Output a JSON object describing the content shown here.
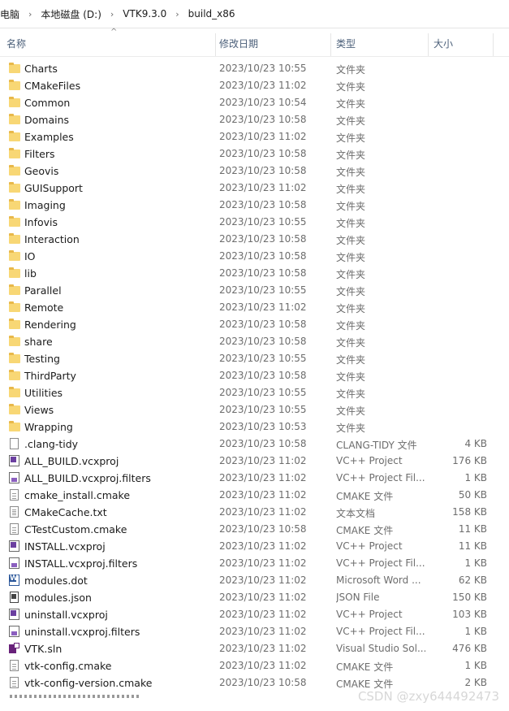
{
  "breadcrumb": {
    "items": [
      "电脑",
      "本地磁盘 (D:)",
      "VTK9.3.0",
      "build_x86"
    ],
    "separator": "›"
  },
  "columns": {
    "name": "名称",
    "date": "修改日期",
    "type": "类型",
    "size": "大小",
    "sort_indicator": "^"
  },
  "files": [
    {
      "name": "Charts",
      "date": "2023/10/23 10:55",
      "type": "文件夹",
      "size": "",
      "icon": "folder-icon"
    },
    {
      "name": "CMakeFiles",
      "date": "2023/10/23 11:02",
      "type": "文件夹",
      "size": "",
      "icon": "folder-icon"
    },
    {
      "name": "Common",
      "date": "2023/10/23 10:54",
      "type": "文件夹",
      "size": "",
      "icon": "folder-icon"
    },
    {
      "name": "Domains",
      "date": "2023/10/23 10:58",
      "type": "文件夹",
      "size": "",
      "icon": "folder-icon"
    },
    {
      "name": "Examples",
      "date": "2023/10/23 11:02",
      "type": "文件夹",
      "size": "",
      "icon": "folder-icon"
    },
    {
      "name": "Filters",
      "date": "2023/10/23 10:58",
      "type": "文件夹",
      "size": "",
      "icon": "folder-icon"
    },
    {
      "name": "Geovis",
      "date": "2023/10/23 10:58",
      "type": "文件夹",
      "size": "",
      "icon": "folder-icon"
    },
    {
      "name": "GUISupport",
      "date": "2023/10/23 11:02",
      "type": "文件夹",
      "size": "",
      "icon": "folder-icon"
    },
    {
      "name": "Imaging",
      "date": "2023/10/23 10:58",
      "type": "文件夹",
      "size": "",
      "icon": "folder-icon"
    },
    {
      "name": "Infovis",
      "date": "2023/10/23 10:55",
      "type": "文件夹",
      "size": "",
      "icon": "folder-icon"
    },
    {
      "name": "Interaction",
      "date": "2023/10/23 10:58",
      "type": "文件夹",
      "size": "",
      "icon": "folder-icon"
    },
    {
      "name": "IO",
      "date": "2023/10/23 10:58",
      "type": "文件夹",
      "size": "",
      "icon": "folder-icon"
    },
    {
      "name": "lib",
      "date": "2023/10/23 10:58",
      "type": "文件夹",
      "size": "",
      "icon": "folder-icon"
    },
    {
      "name": "Parallel",
      "date": "2023/10/23 10:55",
      "type": "文件夹",
      "size": "",
      "icon": "folder-icon"
    },
    {
      "name": "Remote",
      "date": "2023/10/23 11:02",
      "type": "文件夹",
      "size": "",
      "icon": "folder-icon"
    },
    {
      "name": "Rendering",
      "date": "2023/10/23 10:58",
      "type": "文件夹",
      "size": "",
      "icon": "folder-icon"
    },
    {
      "name": "share",
      "date": "2023/10/23 10:58",
      "type": "文件夹",
      "size": "",
      "icon": "folder-icon"
    },
    {
      "name": "Testing",
      "date": "2023/10/23 10:55",
      "type": "文件夹",
      "size": "",
      "icon": "folder-icon"
    },
    {
      "name": "ThirdParty",
      "date": "2023/10/23 10:58",
      "type": "文件夹",
      "size": "",
      "icon": "folder-icon"
    },
    {
      "name": "Utilities",
      "date": "2023/10/23 10:55",
      "type": "文件夹",
      "size": "",
      "icon": "folder-icon"
    },
    {
      "name": "Views",
      "date": "2023/10/23 10:55",
      "type": "文件夹",
      "size": "",
      "icon": "folder-icon"
    },
    {
      "name": "Wrapping",
      "date": "2023/10/23 10:53",
      "type": "文件夹",
      "size": "",
      "icon": "folder-icon"
    },
    {
      "name": ".clang-tidy",
      "date": "2023/10/23 10:58",
      "type": "CLANG-TIDY 文件",
      "size": "4 KB",
      "icon": "file-icon"
    },
    {
      "name": "ALL_BUILD.vcxproj",
      "date": "2023/10/23 11:02",
      "type": "VC++ Project",
      "size": "176 KB",
      "icon": "vcxproj-icon"
    },
    {
      "name": "ALL_BUILD.vcxproj.filters",
      "date": "2023/10/23 11:02",
      "type": "VC++ Project Fil...",
      "size": "1 KB",
      "icon": "filters-icon"
    },
    {
      "name": "cmake_install.cmake",
      "date": "2023/10/23 11:02",
      "type": "CMAKE 文件",
      "size": "50 KB",
      "icon": "cmake-icon"
    },
    {
      "name": "CMakeCache.txt",
      "date": "2023/10/23 11:02",
      "type": "文本文档",
      "size": "158 KB",
      "icon": "text-icon"
    },
    {
      "name": "CTestCustom.cmake",
      "date": "2023/10/23 10:58",
      "type": "CMAKE 文件",
      "size": "11 KB",
      "icon": "cmake-icon"
    },
    {
      "name": "INSTALL.vcxproj",
      "date": "2023/10/23 11:02",
      "type": "VC++ Project",
      "size": "11 KB",
      "icon": "vcxproj-icon"
    },
    {
      "name": "INSTALL.vcxproj.filters",
      "date": "2023/10/23 11:02",
      "type": "VC++ Project Fil...",
      "size": "1 KB",
      "icon": "filters-icon"
    },
    {
      "name": "modules.dot",
      "date": "2023/10/23 11:02",
      "type": "Microsoft Word ...",
      "size": "62 KB",
      "icon": "word-icon"
    },
    {
      "name": "modules.json",
      "date": "2023/10/23 11:02",
      "type": "JSON File",
      "size": "150 KB",
      "icon": "json-icon"
    },
    {
      "name": "uninstall.vcxproj",
      "date": "2023/10/23 11:02",
      "type": "VC++ Project",
      "size": "103 KB",
      "icon": "vcxproj-icon"
    },
    {
      "name": "uninstall.vcxproj.filters",
      "date": "2023/10/23 11:02",
      "type": "VC++ Project Fil...",
      "size": "1 KB",
      "icon": "filters-icon"
    },
    {
      "name": "VTK.sln",
      "date": "2023/10/23 11:02",
      "type": "Visual Studio Sol...",
      "size": "476 KB",
      "icon": "sln-icon"
    },
    {
      "name": "vtk-config.cmake",
      "date": "2023/10/23 11:02",
      "type": "CMAKE 文件",
      "size": "1 KB",
      "icon": "cmake-icon"
    },
    {
      "name": "vtk-config-version.cmake",
      "date": "2023/10/23 10:58",
      "type": "CMAKE 文件",
      "size": "2 KB",
      "icon": "cmake-icon"
    }
  ],
  "watermark": "CSDN @zxy644492473"
}
